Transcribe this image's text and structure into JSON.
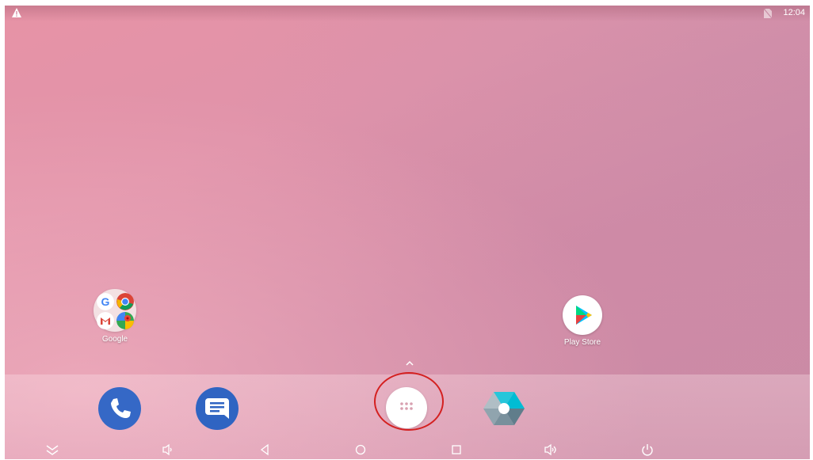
{
  "status_bar": {
    "time": "12:04",
    "left_icon": "warning-icon",
    "right_icon": "no-sim-icon"
  },
  "home_screen": {
    "folder": {
      "label": "Google",
      "apps": [
        "google-icon",
        "chrome-icon",
        "gmail-icon",
        "maps-icon"
      ]
    },
    "shortcut": {
      "label": "Play Store",
      "icon": "play-store-icon"
    }
  },
  "dock": {
    "apps": [
      "phone-icon",
      "messages-icon",
      "app-drawer-icon",
      "camera-icon"
    ],
    "drawer_arrow": "^"
  },
  "nav_bar": {
    "buttons": [
      "collapse-icon",
      "volume-down-icon",
      "back-icon",
      "home-icon",
      "recents-icon",
      "volume-up-icon",
      "power-icon"
    ]
  },
  "colors": {
    "wallpaper": "#e093aa",
    "highlight_ring": "#d42020",
    "phone": "#3568c6",
    "messages": "#2f64c2"
  }
}
